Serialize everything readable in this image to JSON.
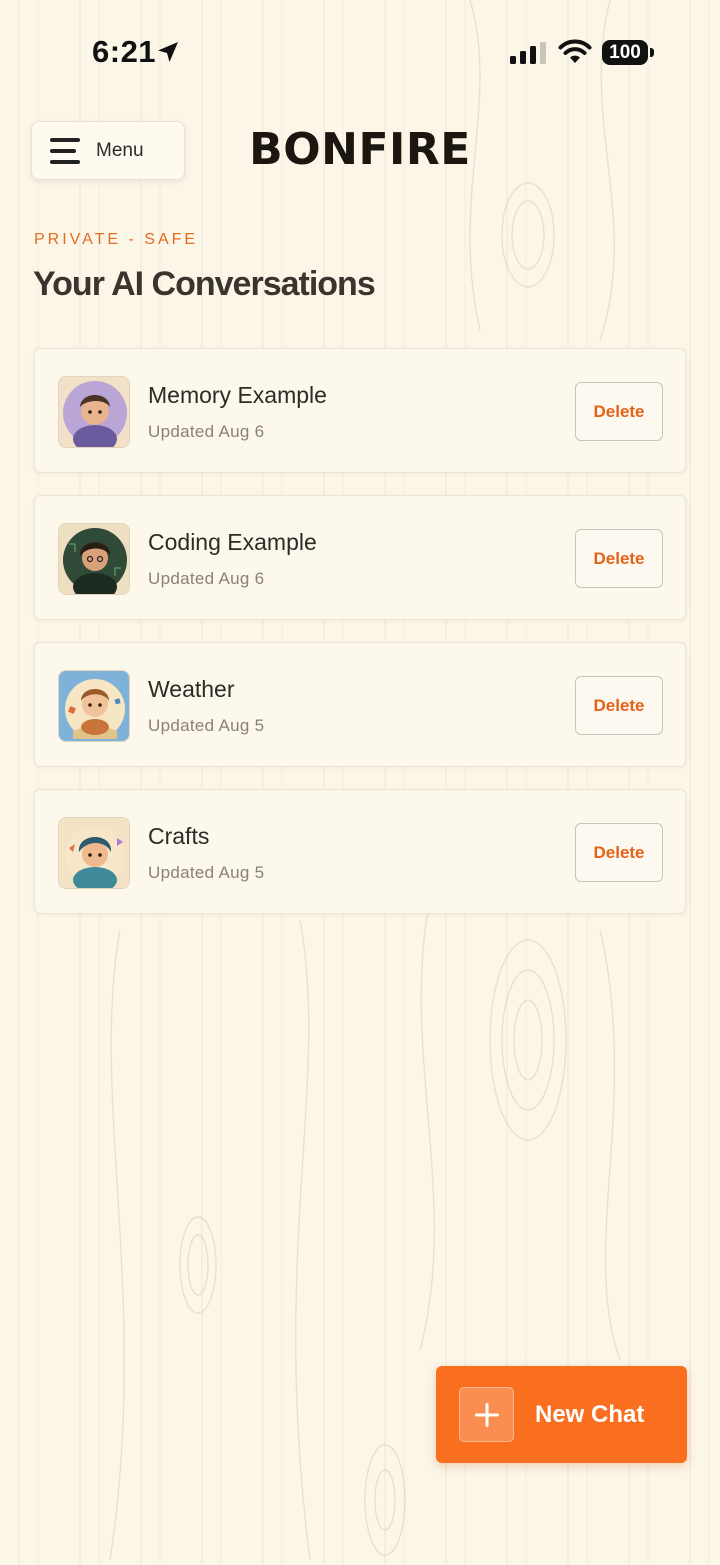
{
  "status_bar": {
    "time": "6:21",
    "battery": "100",
    "icons": [
      "location-arrow-icon",
      "cellular-signal-icon",
      "wifi-icon",
      "battery-icon"
    ]
  },
  "header": {
    "menu_label": "Menu",
    "brand": "BONFIRE"
  },
  "page": {
    "eyebrow": "PRIVATE - SAFE",
    "title": "Your AI Conversations"
  },
  "conversations": [
    {
      "name": "Memory Example",
      "updated": "Updated Aug 6",
      "delete_label": "Delete",
      "avatar": "avatar-boy-purple-scarf"
    },
    {
      "name": "Coding Example",
      "updated": "Updated Aug 6",
      "delete_label": "Delete",
      "avatar": "avatar-boy-green-circuit"
    },
    {
      "name": "Weather",
      "updated": "Updated Aug 5",
      "delete_label": "Delete",
      "avatar": "avatar-boy-book-blue"
    },
    {
      "name": "Crafts",
      "updated": "Updated Aug 5",
      "delete_label": "Delete",
      "avatar": "avatar-boy-teal-hood"
    }
  ],
  "fab": {
    "label": "New Chat"
  },
  "colors": {
    "accent": "#f96f1f",
    "eyebrow": "#e56b1f",
    "background": "#fcf6e9",
    "card": "#fdf8ec"
  }
}
